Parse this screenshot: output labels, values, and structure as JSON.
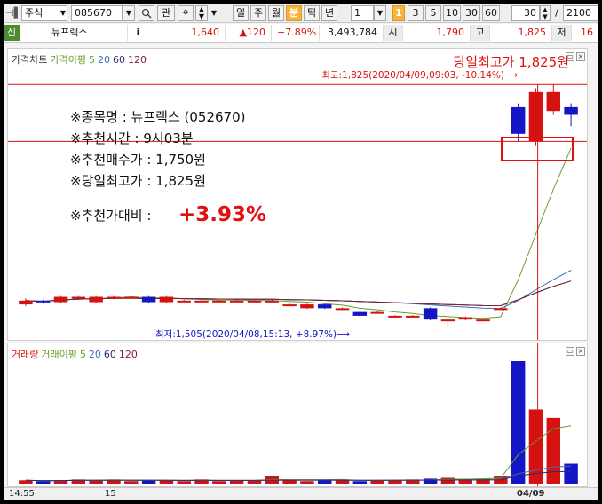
{
  "toolbar": {
    "market": "주식",
    "code": "085670",
    "btn_gwan": "관",
    "periods": [
      "일",
      "주",
      "월",
      "분",
      "틱",
      "년"
    ],
    "active_period": "분",
    "interval_value": "1",
    "minute_options": [
      "1",
      "3",
      "5",
      "10",
      "30",
      "60"
    ],
    "count_value": "30",
    "count_total": "2100"
  },
  "quote": {
    "badge": "신",
    "name": "뉴프렉스",
    "info": "i",
    "price": "1,640",
    "change": "▲120",
    "change_pct": "+7.89%",
    "volume": "3,493,784",
    "open_label": "시",
    "open_value": "1,790",
    "high_label": "고",
    "high_value": "1,825",
    "low_label": "저",
    "low_value": "16"
  },
  "price_legend": {
    "chart_name": "가격차트",
    "ma_label": "가격이평",
    "ma_periods": [
      "5",
      "20",
      "60",
      "120"
    ]
  },
  "volume_legend": {
    "chart_name": "거래량",
    "ma_label": "거래이평",
    "ma_periods": [
      "5",
      "20",
      "60",
      "120"
    ]
  },
  "annotations": {
    "headline": "당일최고가 1,825원",
    "high_marker": "최고:1,825(2020/04/09,09:03, -10.14%)⟶",
    "low_marker": "최저:1,505(2020/04/08,15:13, +8.97%)⟶",
    "note_lines": [
      "※종목명 : 뉴프렉스 (052670)",
      "※추천시간 : 9시03분",
      "※추천매수가 : 1,750원",
      "※당일최고가 : 1,825원"
    ],
    "note_ratio_label": "※추천가대비 :",
    "note_ratio_value": "+3.93%"
  },
  "time_axis": {
    "labels": [
      "14:55",
      "15",
      "04/09"
    ]
  },
  "colors": {
    "up": "#d41212",
    "down": "#1515c8",
    "ma5": "#6a9e2a",
    "ma20": "#3a6fb0",
    "ma60": "#2b2b70",
    "ma120": "#7a1f3c",
    "annotation": "#e01010"
  },
  "chart_data": {
    "type": "candlestick",
    "price_candles": [
      {
        "o": 1535,
        "c": 1540,
        "h": 1543,
        "l": 1533
      },
      {
        "o": 1540,
        "c": 1538,
        "h": 1541,
        "l": 1536
      },
      {
        "o": 1538,
        "c": 1545,
        "h": 1546,
        "l": 1537
      },
      {
        "o": 1545,
        "c": 1545,
        "h": 1546,
        "l": 1544
      },
      {
        "o": 1538,
        "c": 1545,
        "h": 1546,
        "l": 1537
      },
      {
        "o": 1545,
        "c": 1545,
        "h": 1546,
        "l": 1544
      },
      {
        "o": 1545,
        "c": 1545,
        "h": 1546,
        "l": 1544
      },
      {
        "o": 1545,
        "c": 1538,
        "h": 1546,
        "l": 1537
      },
      {
        "o": 1538,
        "c": 1545,
        "h": 1546,
        "l": 1537
      },
      {
        "o": 1540,
        "c": 1540,
        "h": 1541,
        "l": 1539
      },
      {
        "o": 1540,
        "c": 1540,
        "h": 1541,
        "l": 1539
      },
      {
        "o": 1540,
        "c": 1540,
        "h": 1541,
        "l": 1539
      },
      {
        "o": 1540,
        "c": 1540,
        "h": 1541,
        "l": 1539
      },
      {
        "o": 1540,
        "c": 1540,
        "h": 1541,
        "l": 1539
      },
      {
        "o": 1540,
        "c": 1540,
        "h": 1541,
        "l": 1539
      },
      {
        "o": 1535,
        "c": 1535,
        "h": 1536,
        "l": 1534
      },
      {
        "o": 1530,
        "c": 1535,
        "h": 1536,
        "l": 1529
      },
      {
        "o": 1535,
        "c": 1530,
        "h": 1536,
        "l": 1529
      },
      {
        "o": 1530,
        "c": 1530,
        "h": 1531,
        "l": 1529
      },
      {
        "o": 1525,
        "c": 1520,
        "h": 1526,
        "l": 1519
      },
      {
        "o": 1525,
        "c": 1525,
        "h": 1526,
        "l": 1524
      },
      {
        "o": 1520,
        "c": 1520,
        "h": 1521,
        "l": 1519
      },
      {
        "o": 1520,
        "c": 1520,
        "h": 1521,
        "l": 1519
      },
      {
        "o": 1530,
        "c": 1515,
        "h": 1531,
        "l": 1514
      },
      {
        "o": 1515,
        "c": 1515,
        "h": 1516,
        "l": 1505
      },
      {
        "o": 1515,
        "c": 1518,
        "h": 1519,
        "l": 1514
      },
      {
        "o": 1515,
        "c": 1515,
        "h": 1516,
        "l": 1514
      },
      {
        "o": 1530,
        "c": 1530,
        "h": 1531,
        "l": 1529
      },
      {
        "o": 1795,
        "c": 1760,
        "h": 1800,
        "l": 1750
      },
      {
        "o": 1750,
        "c": 1815,
        "h": 1820,
        "l": 1745
      },
      {
        "o": 1790,
        "c": 1815,
        "h": 1825,
        "l": 1785
      },
      {
        "o": 1795,
        "c": 1785,
        "h": 1800,
        "l": 1770
      }
    ],
    "volumes": [
      5,
      4,
      5,
      6,
      5,
      6,
      4,
      5,
      5,
      4,
      6,
      4,
      5,
      5,
      10,
      5,
      4,
      5,
      6,
      4,
      5,
      5,
      6,
      7,
      8,
      6,
      7,
      10,
      148,
      90,
      80,
      25
    ],
    "ylim": [
      1500,
      1830
    ]
  }
}
